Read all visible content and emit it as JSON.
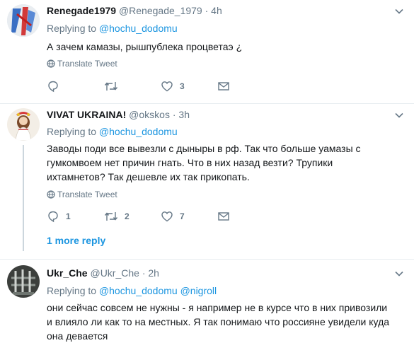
{
  "tweets": [
    {
      "name": "Renegade1979",
      "handle": "@Renegade_1979",
      "time": "4h",
      "replying_label": "Replying to",
      "mentions": [
        "@hochu_dodomu"
      ],
      "text": "А зачем камазы, рышпублека процветаэ ¿",
      "translate": "Translate Tweet",
      "reply_count": "",
      "retweet_count": "",
      "like_count": "3"
    },
    {
      "name": "VIVAT UKRAINA!",
      "handle": "@okskos",
      "time": "3h",
      "replying_label": "Replying to",
      "mentions": [
        "@hochu_dodomu"
      ],
      "text_lines": [
        "Заводы поди все вывезли с дыныры в рф.  Так что больше уамазы с",
        "гумкомвоем нет причин гнать.  Что в них назад везти?  Трупики",
        "ихтамнетов?  Так дешевле их так прикопать."
      ],
      "translate": "Translate Tweet",
      "reply_count": "1",
      "retweet_count": "2",
      "like_count": "7",
      "more_replies": "1 more reply"
    },
    {
      "name": "Ukr_Che",
      "handle": "@Ukr_Che",
      "time": "2h",
      "replying_label": "Replying to",
      "mentions": [
        "@hochu_dodomu",
        "@nigroll"
      ],
      "text_lines": [
        "они сейчас совсем не нужны - я например не в курсе что в них привозили",
        "и влияло ли как то на местных. Я так понимаю что россияне увидели куда",
        "она девается"
      ]
    }
  ],
  "separator": "·",
  "colors": {
    "text": "#14171a",
    "secondary": "#657786",
    "link": "#1b95e0",
    "divider": "#e6ecf0"
  },
  "icons": [
    "chevron-down-icon",
    "globe-icon",
    "reply-icon",
    "retweet-icon",
    "like-icon",
    "message-icon"
  ]
}
